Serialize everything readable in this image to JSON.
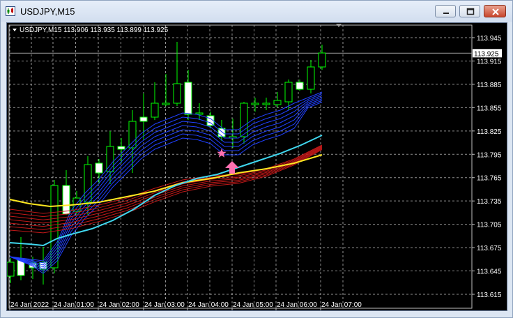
{
  "window": {
    "title": "USDJPY,M15"
  },
  "chart": {
    "header": "USDJPY,M15  113.906 113.935 113.899 113.925",
    "current_price": "113.925",
    "price_labels": [
      "113.945",
      "113.915",
      "113.885",
      "113.855",
      "113.825",
      "113.795",
      "113.765",
      "113.735",
      "113.705",
      "113.675",
      "113.645",
      "113.615"
    ],
    "time_labels": [
      "24 Jan 2022",
      "24 Jan 01:00",
      "24 Jan 02:00",
      "24 Jan 03:00",
      "24 Jan 04:00",
      "24 Jan 05:00",
      "24 Jan 06:00",
      "24 Jan 07:00"
    ],
    "colors": {
      "background": "#000000",
      "grid": "#c0c0c0",
      "bull": "#00ff00",
      "bear": "#ffffff",
      "ema_blue": "#2040ff",
      "ema_red": "#c01818",
      "ema_cyan": "#40d8f0",
      "ema_yellow": "#ffe820",
      "signal_star": "#ff6fb0",
      "signal_arrow": "#ff6fb0"
    }
  }
}
